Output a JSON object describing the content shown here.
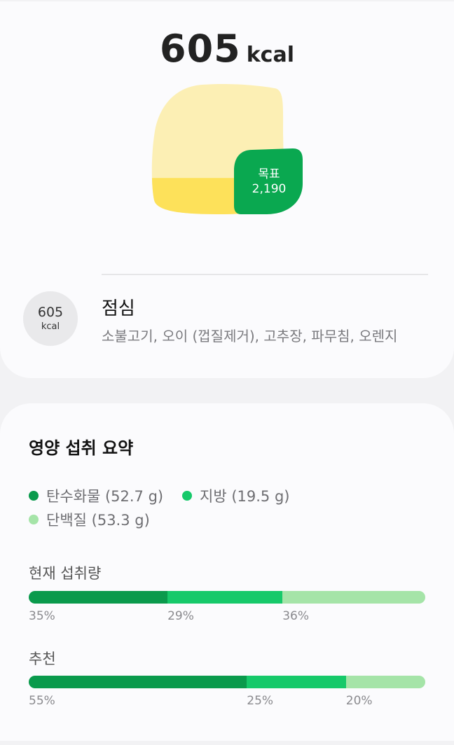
{
  "summary": {
    "calories_value": "605",
    "calories_unit": "kcal",
    "goal_label": "목표",
    "goal_value": "2,190",
    "consumed_fraction": 0.28
  },
  "meal": {
    "kcal_value": "605",
    "kcal_unit": "kcal",
    "name": "점심",
    "foods": "소불고기, 오이 (껍질제거), 고추장, 파무침, 오렌지"
  },
  "nutrition": {
    "title": "영양 섭취 요약",
    "legend": [
      {
        "label": "탄수화물 (52.7 g)",
        "color": "#0a9a4c"
      },
      {
        "label": "지방 (19.5 g)",
        "color": "#16c96a"
      },
      {
        "label": "단백질 (53.3 g)",
        "color": "#a5e4a8"
      }
    ],
    "current": {
      "title": "현재 섭취량",
      "segments": [
        {
          "percent": 35,
          "label": "35%",
          "color": "#0a9a4c"
        },
        {
          "percent": 29,
          "label": "29%",
          "color": "#16c96a"
        },
        {
          "percent": 36,
          "label": "36%",
          "color": "#a5e4a8"
        }
      ]
    },
    "recommended": {
      "title": "추천",
      "segments": [
        {
          "percent": 55,
          "label": "55%",
          "color": "#0a9a4c"
        },
        {
          "percent": 25,
          "label": "25%",
          "color": "#16c96a"
        },
        {
          "percent": 20,
          "label": "20%",
          "color": "#a5e4a8"
        }
      ]
    }
  },
  "colors": {
    "blob_light": "#fcefb4",
    "blob_fill": "#fde15a",
    "goal_green": "#0aa850"
  }
}
